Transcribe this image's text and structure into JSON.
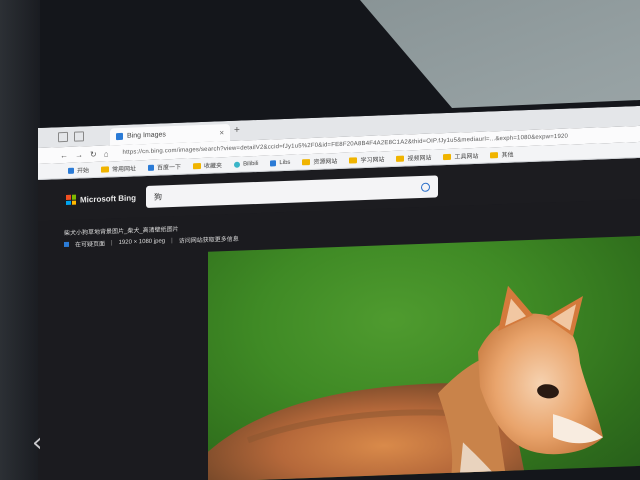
{
  "browser": {
    "tab_title": "Bing Images",
    "tab_close": "×",
    "new_tab": "+",
    "url": "https://cn.bing.com/images/search?view=detailV2&ccid=fJy1u5%2F0&id=FE8F20A8B4F4A2E8C1A2&thid=OIP.fJy1u5&mediaurl=...&exph=1080&expw=1920",
    "bookmarks": [
      {
        "icon": "windows-icon",
        "label": "开始"
      },
      {
        "icon": "folder-icon",
        "label": "常用网址"
      },
      {
        "icon": "page-icon",
        "label": "百度一下"
      },
      {
        "icon": "folder-icon",
        "label": "收藏夹"
      },
      {
        "icon": "globe-icon",
        "label": "Bilibili"
      },
      {
        "icon": "page-icon",
        "label": "Libs"
      },
      {
        "icon": "folder-icon",
        "label": "资源网站"
      },
      {
        "icon": "folder-icon",
        "label": "学习网站"
      },
      {
        "icon": "folder-icon",
        "label": "视频网站"
      },
      {
        "icon": "folder-icon",
        "label": "工具网站"
      },
      {
        "icon": "folder-icon",
        "label": "其他"
      }
    ]
  },
  "bing": {
    "brand": "Microsoft Bing",
    "search_value": "狗",
    "info_title": "柴犬小狗草地背景图片_柴犬_高清壁纸图片",
    "info_source": "在可疑页面",
    "info_size": "1920 × 1080 jpeg",
    "info_link": "访问网站获取更多信息"
  },
  "colors": {
    "ms_red": "#f25022",
    "ms_green": "#7fba00",
    "ms_blue": "#00a4ef",
    "ms_yellow": "#ffb900"
  }
}
